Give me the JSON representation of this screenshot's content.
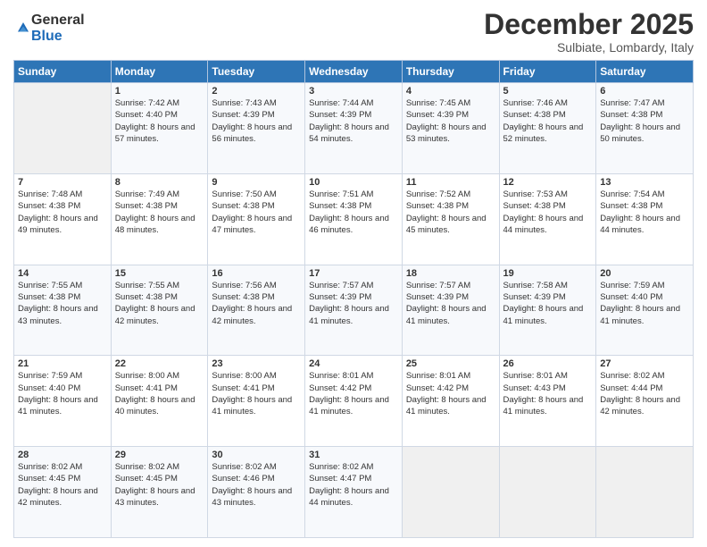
{
  "logo": {
    "general": "General",
    "blue": "Blue"
  },
  "header": {
    "month": "December 2025",
    "location": "Sulbiate, Lombardy, Italy"
  },
  "weekdays": [
    "Sunday",
    "Monday",
    "Tuesday",
    "Wednesday",
    "Thursday",
    "Friday",
    "Saturday"
  ],
  "weeks": [
    [
      {
        "day": "",
        "empty": true
      },
      {
        "day": "1",
        "sunrise": "7:42 AM",
        "sunset": "4:40 PM",
        "daylight": "8 hours and 57 minutes."
      },
      {
        "day": "2",
        "sunrise": "7:43 AM",
        "sunset": "4:39 PM",
        "daylight": "8 hours and 56 minutes."
      },
      {
        "day": "3",
        "sunrise": "7:44 AM",
        "sunset": "4:39 PM",
        "daylight": "8 hours and 54 minutes."
      },
      {
        "day": "4",
        "sunrise": "7:45 AM",
        "sunset": "4:39 PM",
        "daylight": "8 hours and 53 minutes."
      },
      {
        "day": "5",
        "sunrise": "7:46 AM",
        "sunset": "4:38 PM",
        "daylight": "8 hours and 52 minutes."
      },
      {
        "day": "6",
        "sunrise": "7:47 AM",
        "sunset": "4:38 PM",
        "daylight": "8 hours and 50 minutes."
      }
    ],
    [
      {
        "day": "7",
        "sunrise": "7:48 AM",
        "sunset": "4:38 PM",
        "daylight": "8 hours and 49 minutes."
      },
      {
        "day": "8",
        "sunrise": "7:49 AM",
        "sunset": "4:38 PM",
        "daylight": "8 hours and 48 minutes."
      },
      {
        "day": "9",
        "sunrise": "7:50 AM",
        "sunset": "4:38 PM",
        "daylight": "8 hours and 47 minutes."
      },
      {
        "day": "10",
        "sunrise": "7:51 AM",
        "sunset": "4:38 PM",
        "daylight": "8 hours and 46 minutes."
      },
      {
        "day": "11",
        "sunrise": "7:52 AM",
        "sunset": "4:38 PM",
        "daylight": "8 hours and 45 minutes."
      },
      {
        "day": "12",
        "sunrise": "7:53 AM",
        "sunset": "4:38 PM",
        "daylight": "8 hours and 44 minutes."
      },
      {
        "day": "13",
        "sunrise": "7:54 AM",
        "sunset": "4:38 PM",
        "daylight": "8 hours and 44 minutes."
      }
    ],
    [
      {
        "day": "14",
        "sunrise": "7:55 AM",
        "sunset": "4:38 PM",
        "daylight": "8 hours and 43 minutes."
      },
      {
        "day": "15",
        "sunrise": "7:55 AM",
        "sunset": "4:38 PM",
        "daylight": "8 hours and 42 minutes."
      },
      {
        "day": "16",
        "sunrise": "7:56 AM",
        "sunset": "4:38 PM",
        "daylight": "8 hours and 42 minutes."
      },
      {
        "day": "17",
        "sunrise": "7:57 AM",
        "sunset": "4:39 PM",
        "daylight": "8 hours and 41 minutes."
      },
      {
        "day": "18",
        "sunrise": "7:57 AM",
        "sunset": "4:39 PM",
        "daylight": "8 hours and 41 minutes."
      },
      {
        "day": "19",
        "sunrise": "7:58 AM",
        "sunset": "4:39 PM",
        "daylight": "8 hours and 41 minutes."
      },
      {
        "day": "20",
        "sunrise": "7:59 AM",
        "sunset": "4:40 PM",
        "daylight": "8 hours and 41 minutes."
      }
    ],
    [
      {
        "day": "21",
        "sunrise": "7:59 AM",
        "sunset": "4:40 PM",
        "daylight": "8 hours and 41 minutes."
      },
      {
        "day": "22",
        "sunrise": "8:00 AM",
        "sunset": "4:41 PM",
        "daylight": "8 hours and 40 minutes."
      },
      {
        "day": "23",
        "sunrise": "8:00 AM",
        "sunset": "4:41 PM",
        "daylight": "8 hours and 41 minutes."
      },
      {
        "day": "24",
        "sunrise": "8:01 AM",
        "sunset": "4:42 PM",
        "daylight": "8 hours and 41 minutes."
      },
      {
        "day": "25",
        "sunrise": "8:01 AM",
        "sunset": "4:42 PM",
        "daylight": "8 hours and 41 minutes."
      },
      {
        "day": "26",
        "sunrise": "8:01 AM",
        "sunset": "4:43 PM",
        "daylight": "8 hours and 41 minutes."
      },
      {
        "day": "27",
        "sunrise": "8:02 AM",
        "sunset": "4:44 PM",
        "daylight": "8 hours and 42 minutes."
      }
    ],
    [
      {
        "day": "28",
        "sunrise": "8:02 AM",
        "sunset": "4:45 PM",
        "daylight": "8 hours and 42 minutes."
      },
      {
        "day": "29",
        "sunrise": "8:02 AM",
        "sunset": "4:45 PM",
        "daylight": "8 hours and 43 minutes."
      },
      {
        "day": "30",
        "sunrise": "8:02 AM",
        "sunset": "4:46 PM",
        "daylight": "8 hours and 43 minutes."
      },
      {
        "day": "31",
        "sunrise": "8:02 AM",
        "sunset": "4:47 PM",
        "daylight": "8 hours and 44 minutes."
      },
      {
        "day": "",
        "empty": true
      },
      {
        "day": "",
        "empty": true
      },
      {
        "day": "",
        "empty": true
      }
    ]
  ],
  "labels": {
    "sunrise_prefix": "Sunrise: ",
    "sunset_prefix": "Sunset: ",
    "daylight_prefix": "Daylight: "
  }
}
